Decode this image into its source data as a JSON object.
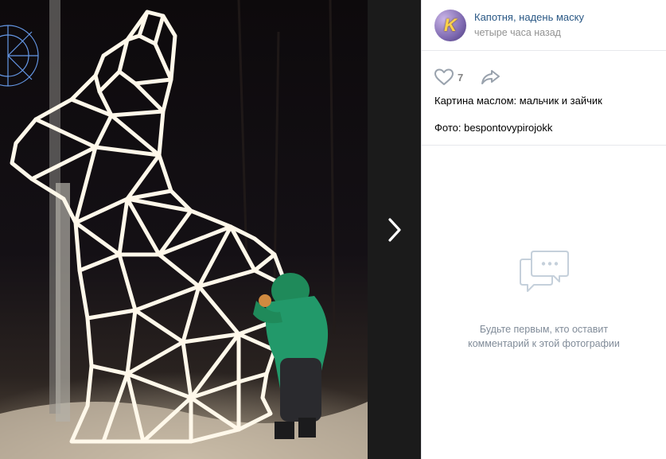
{
  "post": {
    "author": "Капотня, надень маску",
    "time": "четыре часа назад",
    "avatar_letter": "K",
    "likes": "7",
    "description_line1": "Картина маслом: мальчик и зайчик",
    "description_line2": "Фото: bespontovypirojokk"
  },
  "comments": {
    "empty_line1": "Будьте первым, кто оставит",
    "empty_line2": "комментарий к этой фотографии"
  },
  "icons": {
    "like": "heart-icon",
    "share": "share-arrow-icon",
    "next": "chevron-right-icon",
    "comments_empty": "speech-bubbles-icon"
  },
  "colors": {
    "link": "#2a5885",
    "muted": "#939393",
    "icon": "#99a2ad",
    "divider": "#e7e8ec"
  }
}
